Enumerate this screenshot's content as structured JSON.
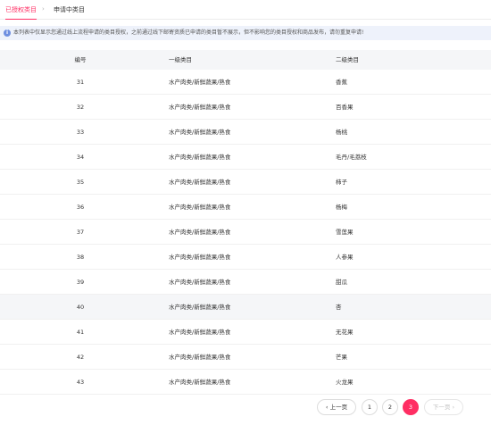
{
  "tabs": {
    "authorized": "已授权类目",
    "applying": "申请中类目",
    "separator": "›"
  },
  "notice": {
    "icon": "i",
    "text": "本列表中仅显示您通过线上流程申请的类目授权，之前通过线下邮寄资质已申请的类目暂不展示，但不影响您的类目授权和商品发布，请勿重复申请!"
  },
  "table": {
    "headers": {
      "id": "编号",
      "level1": "一级类目",
      "level2": "二级类目"
    },
    "rows": [
      {
        "id": "31",
        "level1": "水产肉类/新鲜蔬果/熟食",
        "level2": "香蕉"
      },
      {
        "id": "32",
        "level1": "水产肉类/新鲜蔬果/熟食",
        "level2": "百香果"
      },
      {
        "id": "33",
        "level1": "水产肉类/新鲜蔬果/熟食",
        "level2": "杨桃"
      },
      {
        "id": "34",
        "level1": "水产肉类/新鲜蔬果/熟食",
        "level2": "毛丹/毛荔枝"
      },
      {
        "id": "35",
        "level1": "水产肉类/新鲜蔬果/熟食",
        "level2": "柿子"
      },
      {
        "id": "36",
        "level1": "水产肉类/新鲜蔬果/熟食",
        "level2": "杨梅"
      },
      {
        "id": "37",
        "level1": "水产肉类/新鲜蔬果/熟食",
        "level2": "雪莲果"
      },
      {
        "id": "38",
        "level1": "水产肉类/新鲜蔬果/熟食",
        "level2": "人参果"
      },
      {
        "id": "39",
        "level1": "水产肉类/新鲜蔬果/熟食",
        "level2": "甜瓜"
      },
      {
        "id": "40",
        "level1": "水产肉类/新鲜蔬果/熟食",
        "level2": "杏"
      },
      {
        "id": "41",
        "level1": "水产肉类/新鲜蔬果/熟食",
        "level2": "无花果"
      },
      {
        "id": "42",
        "level1": "水产肉类/新鲜蔬果/熟食",
        "level2": "芒果"
      },
      {
        "id": "43",
        "level1": "水产肉类/新鲜蔬果/熟食",
        "level2": "火龙果"
      }
    ],
    "highlighted_row": 9
  },
  "pagination": {
    "prev": "‹ 上一页",
    "pages": [
      "1",
      "2",
      "3"
    ],
    "current": "3",
    "next": "下一页 ›"
  },
  "colors": {
    "accent": "#ff2e63",
    "notice_bg": "#eef2fb",
    "info_icon": "#6e8fe0",
    "header_bg": "#f5f6f8"
  }
}
